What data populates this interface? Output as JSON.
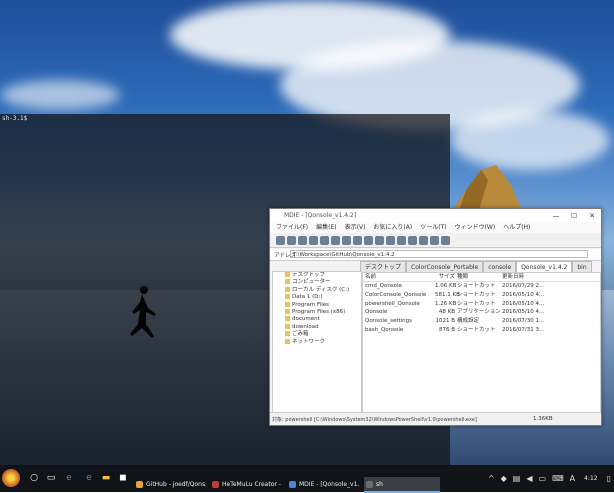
{
  "terminal": {
    "prompt": "sh-3.1$"
  },
  "explorer": {
    "title": "MDIE - [Qonsole_v1.4.2]",
    "menu": [
      "ファイル(F)",
      "編集(E)",
      "表示(V)",
      "お気に入り(A)",
      "ツール(T)",
      "ウィンドウ(W)",
      "ヘルプ(H)"
    ],
    "address_label": "アドレス",
    "address_value": "T:\\Workspace\\GitHub\\Qonsole_v1.4.2",
    "tabs": [
      "デスクトップ",
      "ColorConsole_Portable",
      "console",
      "Qonsole_v1.4.2",
      "bin"
    ],
    "active_tab": "Qonsole_v1.4.2",
    "tree": [
      "デスクトップ",
      "コンピューター",
      "ローカル ディスク (C:)",
      "Data 1 (D:)",
      "Program Files",
      "Program Files (x86)",
      "document",
      "download",
      "ごみ箱",
      "ネットワーク"
    ],
    "columns": [
      "名前",
      "サイズ",
      "種類",
      "更新日時"
    ],
    "files": [
      {
        "name": "cmd_Qonsole",
        "size": "1.06 KB",
        "type": "ショートカット",
        "date": "2016/07/29 2..."
      },
      {
        "name": "ColorConsole_Qonsole",
        "size": "581.1 KB",
        "type": "ショートカット",
        "date": "2016/05/10 4..."
      },
      {
        "name": "powershell_Qonsole",
        "size": "1.26 KB",
        "type": "ショートカット",
        "date": "2016/05/10 4..."
      },
      {
        "name": "Qonsole",
        "size": "48 KB",
        "type": "アプリケーション",
        "date": "2016/05/10 4..."
      },
      {
        "name": "Qonsole_settings",
        "size": "1021 B",
        "type": "構成設定",
        "date": "2016/07/30 1..."
      },
      {
        "name": "bash_Qonsole",
        "size": "876 B",
        "type": "ショートカット",
        "date": "2016/07/31 3..."
      }
    ],
    "status_left": "対象: powershell [C:\\Windows\\System32\\WindowsPowerShell\\v1.0\\powershell.exe]",
    "status_right": "1.36KB"
  },
  "taskbar": {
    "buttons": [
      {
        "label": "GitHub - joedf/Qons...",
        "color": "#e8a23a"
      },
      {
        "label": "HeTeMuLu Creator - ...",
        "color": "#c23b3b"
      },
      {
        "label": "MDIE - [Qonsole_v1.4...",
        "color": "#4b89d6"
      },
      {
        "label": "sh",
        "color": "#6b6b6b"
      }
    ],
    "clock": "4:12",
    "ime": "A"
  }
}
